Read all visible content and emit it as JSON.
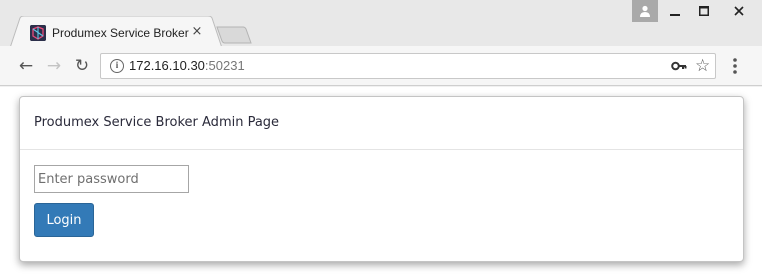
{
  "window": {
    "tab_title": "Produmex Service Broker",
    "tab_close": "×",
    "min_glyph": "—",
    "max_glyph": "☐",
    "close_glyph": "✕"
  },
  "toolbar": {
    "url_host": "172.16.10.30",
    "url_port": ":50231",
    "info_glyph": "i",
    "back_glyph": "←",
    "forward_glyph": "→",
    "reload_glyph": "↻",
    "star_glyph": "☆"
  },
  "page": {
    "panel_title": "Produmex Service Broker Admin Page",
    "password_placeholder": "Enter password",
    "password_value": "",
    "login_label": "Login"
  },
  "colors": {
    "primary_button": "#337ab7",
    "favicon_bg": "#2b2f4a"
  }
}
